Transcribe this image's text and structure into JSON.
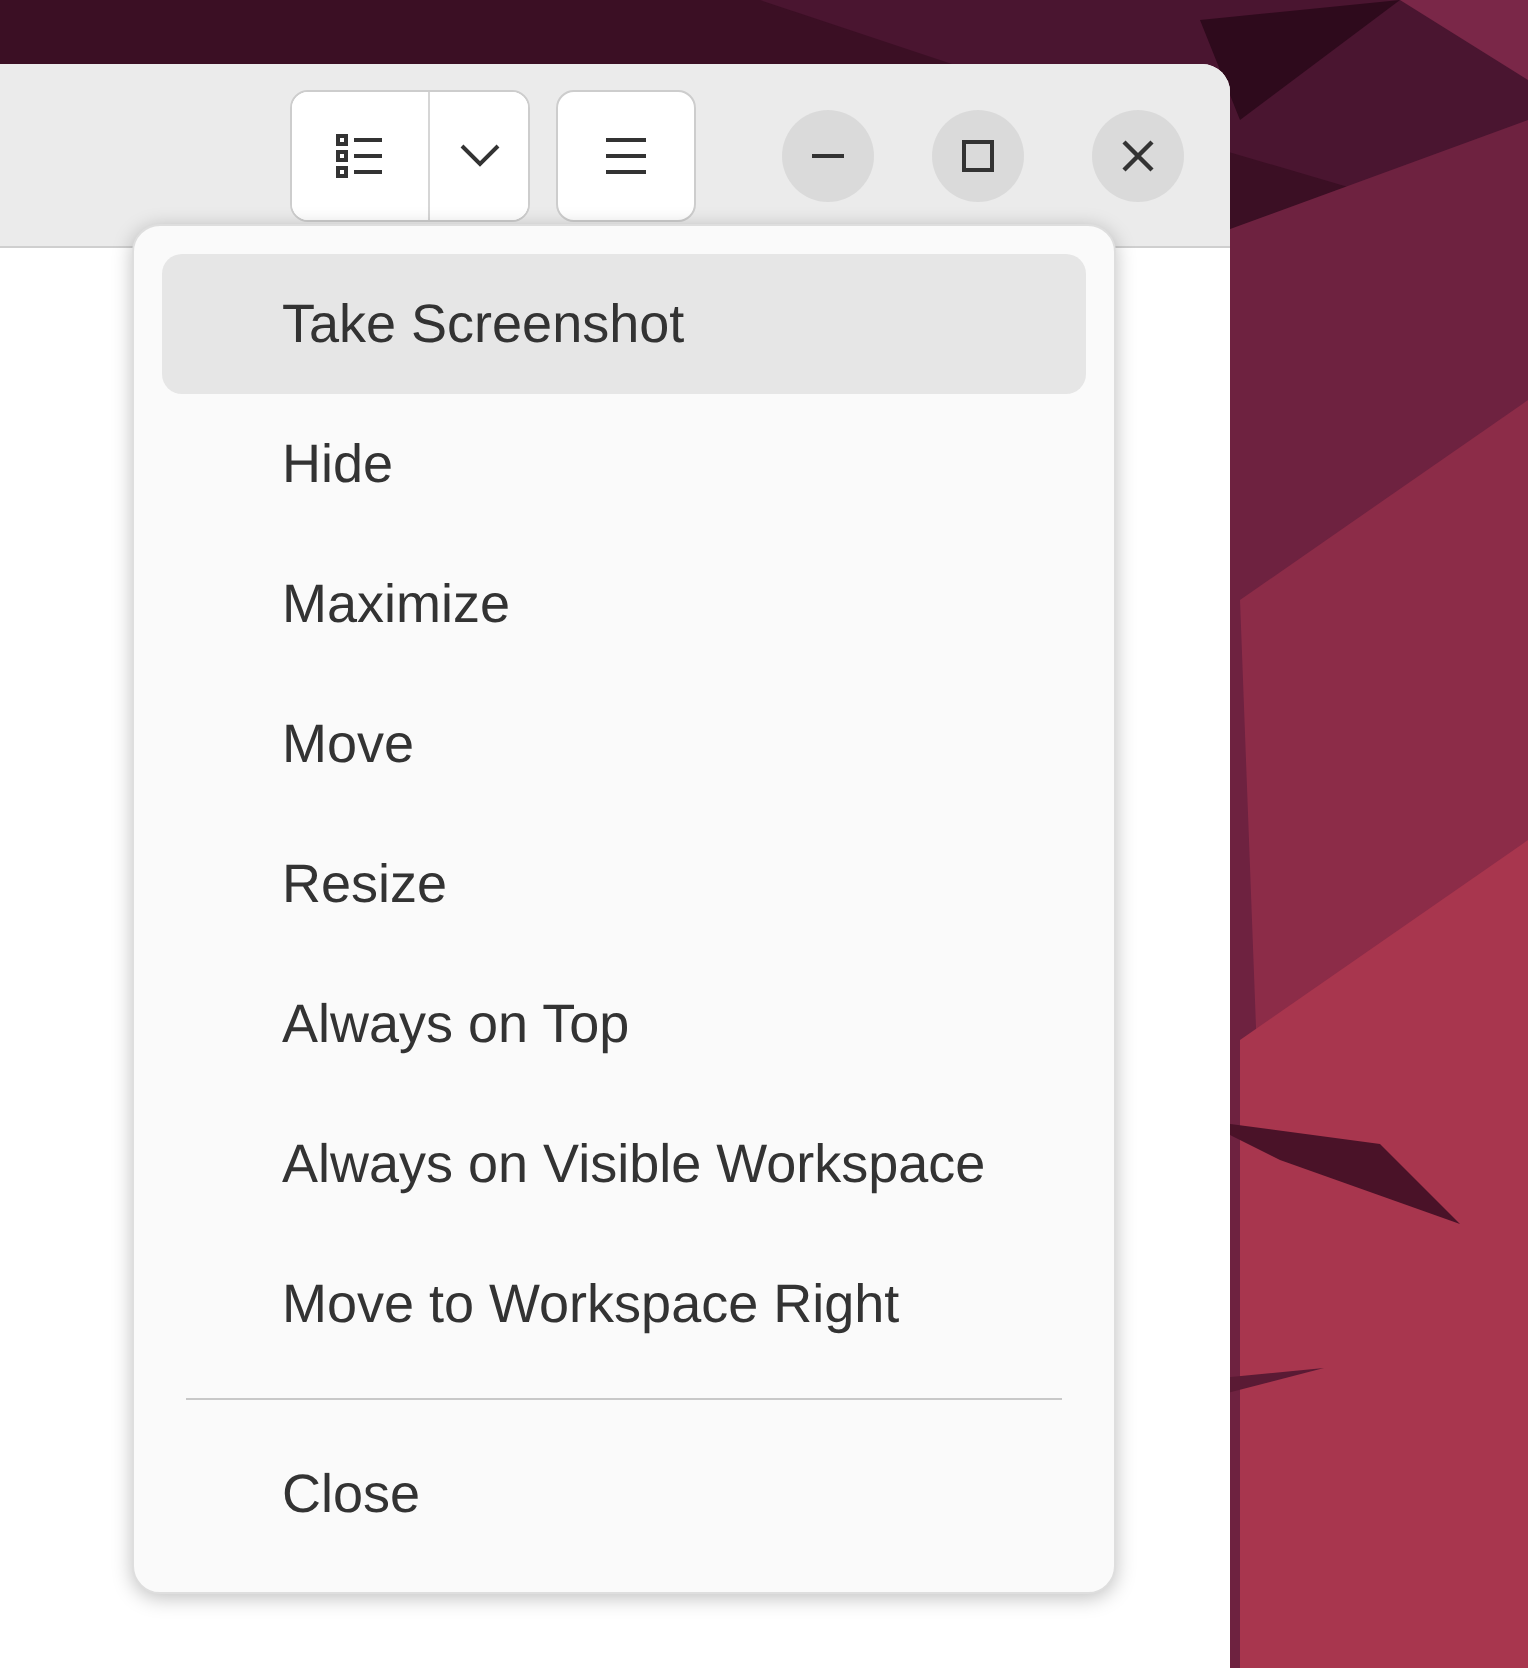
{
  "menu": {
    "sections": [
      {
        "items": [
          {
            "label": "Take Screenshot",
            "selected": true
          },
          {
            "label": "Hide",
            "selected": false
          },
          {
            "label": "Maximize",
            "selected": false
          },
          {
            "label": "Move",
            "selected": false
          },
          {
            "label": "Resize",
            "selected": false
          },
          {
            "label": "Always on Top",
            "selected": false
          },
          {
            "label": "Always on Visible Workspace",
            "selected": false
          },
          {
            "label": "Move to Workspace Right",
            "selected": false
          }
        ]
      },
      {
        "items": [
          {
            "label": "Close",
            "selected": false
          }
        ]
      }
    ]
  }
}
